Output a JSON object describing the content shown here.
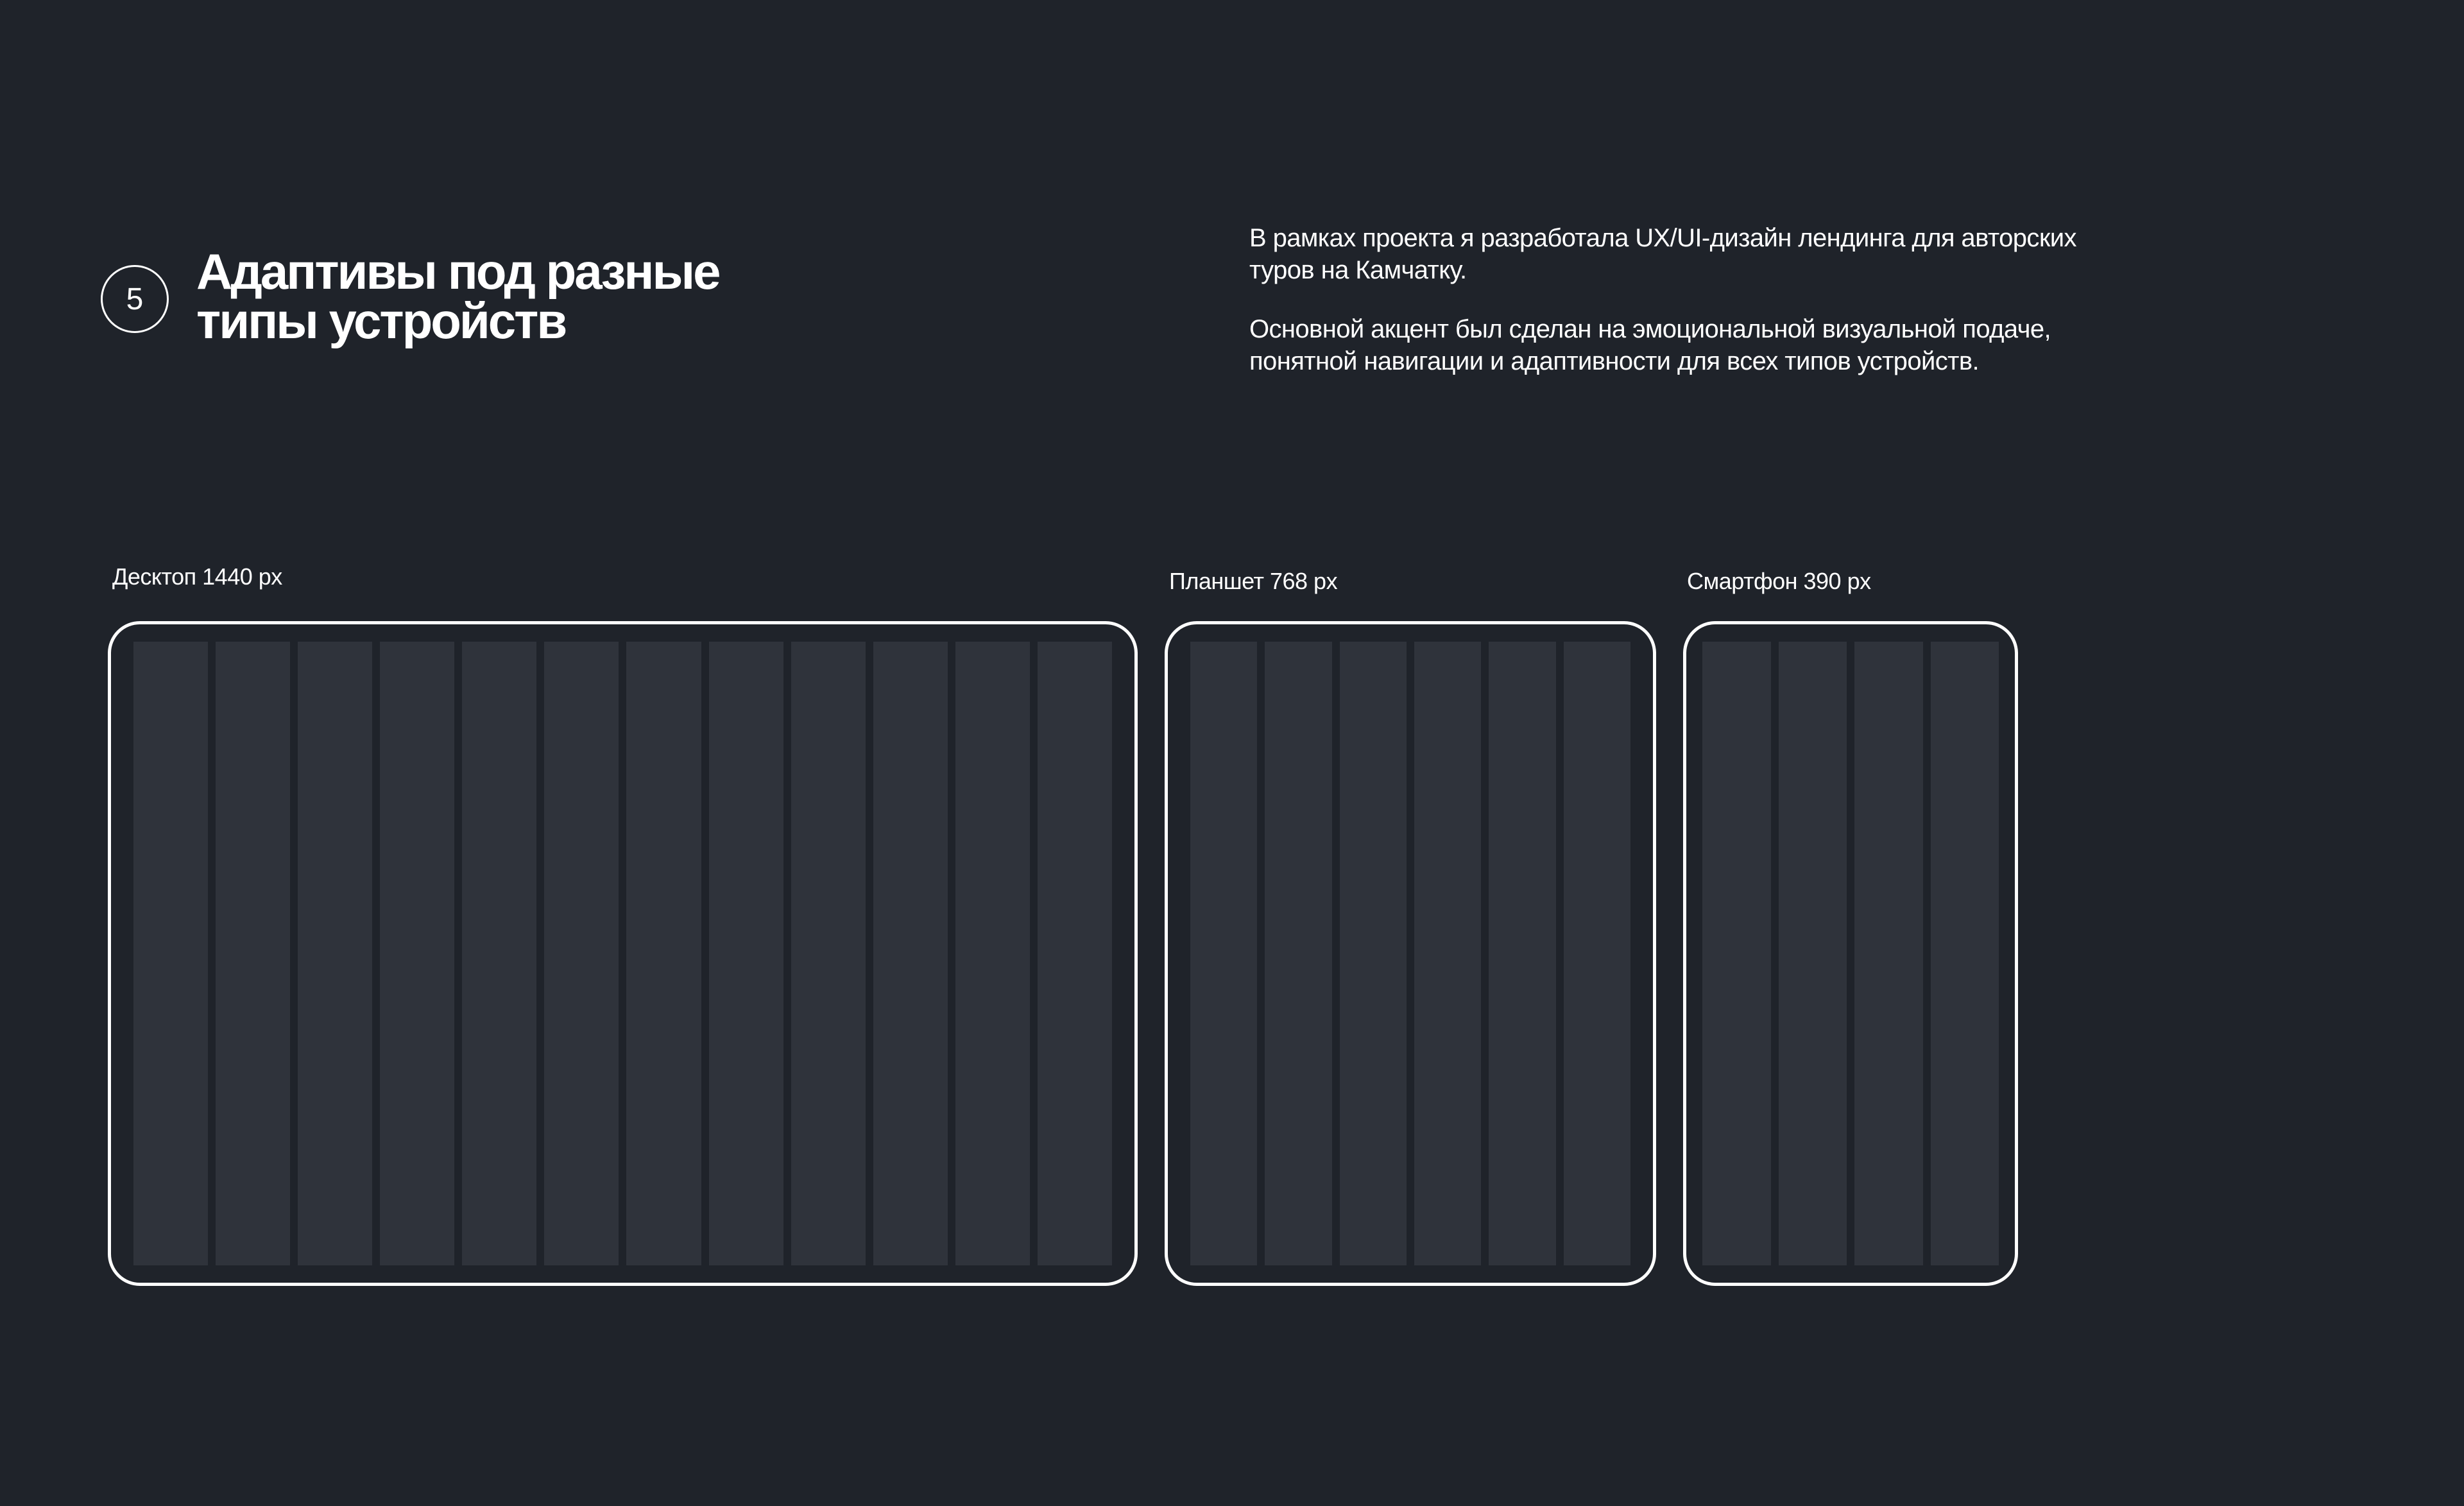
{
  "header": {
    "step_number": "5",
    "title_line1": "Адаптивы под разные",
    "title_line2": "типы устройств"
  },
  "intro": {
    "paragraph1_line1": "В рамках проекта я разработала UX/UI-дизайн лендинга для авторских",
    "paragraph1_line2": "туров на Камчатку.",
    "paragraph2_line1": "Основной акцент был сделан на эмоциональной визуальной подаче,",
    "paragraph2_line2": "понятной навигации и адаптивности для всех типов устройств."
  },
  "devices": [
    {
      "label": "Десктоп 1440 px",
      "columns": 12
    },
    {
      "label": "Планшет 768 px",
      "columns": 6
    },
    {
      "label": "Смартфон 390 px",
      "columns": 4
    }
  ],
  "colors": {
    "background": "#1f232a",
    "frame_border": "#ffffff",
    "grid_column": "#2f333b"
  }
}
